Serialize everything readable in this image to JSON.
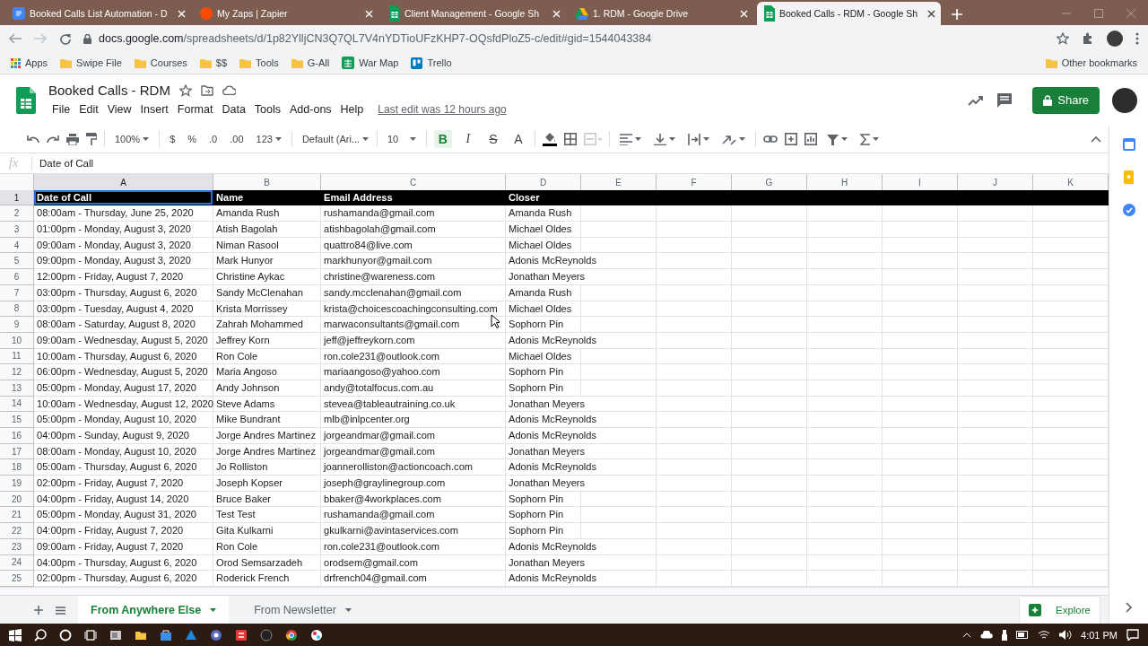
{
  "browser": {
    "tabs": [
      {
        "title": "Booked Calls List Automation - D",
        "kind": "docs",
        "selected": false
      },
      {
        "title": "My Zaps | Zapier",
        "kind": "zapier",
        "selected": false
      },
      {
        "title": "Client Management - Google Sh",
        "kind": "sheets",
        "selected": false
      },
      {
        "title": "1. RDM - Google Drive",
        "kind": "drive",
        "selected": false
      },
      {
        "title": "Booked Calls - RDM - Google Sh",
        "kind": "sheets",
        "selected": true
      }
    ],
    "url_host": "docs.google.com",
    "url_path": "/spreadsheets/d/1p82YlljCN3Q7QL7V4nYDTioUFzKHP7-OQsfdPloZ5-c/edit#gid=1544043384",
    "bookmarks": [
      {
        "label": "Apps",
        "kind": "apps"
      },
      {
        "label": "Swipe File",
        "kind": "folder"
      },
      {
        "label": "Courses",
        "kind": "folder"
      },
      {
        "label": "$$",
        "kind": "folder"
      },
      {
        "label": "Tools",
        "kind": "folder"
      },
      {
        "label": "G-All",
        "kind": "folder"
      },
      {
        "label": "War Map",
        "kind": "sheets"
      },
      {
        "label": "Trello",
        "kind": "trello"
      }
    ],
    "other_bookmarks": "Other bookmarks"
  },
  "sheet": {
    "title": "Booked Calls - RDM",
    "menu": [
      "File",
      "Edit",
      "View",
      "Insert",
      "Format",
      "Data",
      "Tools",
      "Add-ons",
      "Help"
    ],
    "last_edit": "Last edit was 12 hours ago",
    "share": "Share"
  },
  "toolbar": {
    "zoom": "100%",
    "currency": "$",
    "percent": "%",
    "decimal_less": ".0",
    "decimal_more": ".00",
    "number_format": "123",
    "font": "Default (Ari...",
    "font_size": "10",
    "format_buttons": [
      {
        "label": "B",
        "kind": "bold",
        "selected": true
      },
      {
        "label": "I",
        "kind": "italic",
        "selected": false
      },
      {
        "label": "S",
        "kind": "strike",
        "selected": false
      },
      {
        "label": "A",
        "kind": "color",
        "selected": false
      }
    ]
  },
  "formula": {
    "label": "fx",
    "value": "Date of Call"
  },
  "grid": {
    "columns": [
      {
        "letter": "A",
        "selected": true
      },
      {
        "letter": "B",
        "selected": false
      },
      {
        "letter": "C",
        "selected": false
      },
      {
        "letter": "D",
        "selected": false
      },
      {
        "letter": "E",
        "selected": false
      },
      {
        "letter": "F",
        "selected": false
      },
      {
        "letter": "G",
        "selected": false
      },
      {
        "letter": "H",
        "selected": false
      },
      {
        "letter": "I",
        "selected": false
      },
      {
        "letter": "J",
        "selected": false
      },
      {
        "letter": "K",
        "selected": false
      }
    ],
    "rows": [
      {
        "number": "1",
        "kind": "header",
        "selected": true,
        "cells": [
          "Date of Call",
          "Name",
          "Email Address",
          "Closer"
        ]
      },
      {
        "number": "2",
        "kind": "data",
        "selected": false,
        "cells": [
          "08:00am - Thursday, June 25, 2020",
          "Amanda Rush",
          "rushamanda@gmail.com",
          "Amanda Rush"
        ]
      },
      {
        "number": "3",
        "kind": "data",
        "selected": false,
        "cells": [
          "01:00pm - Monday, August 3, 2020",
          "Atish Bagolah",
          "atishbagolah@gmail.com",
          "Michael Oldes"
        ]
      },
      {
        "number": "4",
        "kind": "data",
        "selected": false,
        "cells": [
          "09:00am - Monday, August 3, 2020",
          "Niman Rasool",
          "quattro84@live.com",
          "Michael Oldes"
        ]
      },
      {
        "number": "5",
        "kind": "data",
        "selected": false,
        "cells": [
          "09:00pm - Monday, August 3, 2020",
          "Mark Hunyor",
          "markhunyor@gmail.com",
          "Adonis McReynolds"
        ]
      },
      {
        "number": "6",
        "kind": "data",
        "selected": false,
        "cells": [
          "12:00pm - Friday, August 7, 2020",
          "Christine Aykac",
          "christine@wareness.com",
          "Jonathan Meyers"
        ]
      },
      {
        "number": "7",
        "kind": "data",
        "selected": false,
        "cells": [
          "03:00pm - Thursday, August 6, 2020",
          "Sandy McClenahan",
          "sandy.mcclenahan@gmail.com",
          "Amanda Rush"
        ]
      },
      {
        "number": "8",
        "kind": "data",
        "selected": false,
        "cells": [
          "03:00pm - Tuesday, August 4, 2020",
          "Krista Morrissey",
          "krista@choicescoachingconsulting.com",
          "Michael Oldes"
        ]
      },
      {
        "number": "9",
        "kind": "data",
        "selected": false,
        "cells": [
          "08:00am - Saturday, August 8, 2020",
          "Zahrah Mohammed",
          "marwaconsultants@gmail.com",
          "Sophorn Pin"
        ]
      },
      {
        "number": "10",
        "kind": "data",
        "selected": false,
        "cells": [
          "09:00am - Wednesday, August 5, 2020",
          "Jeffrey Korn",
          "jeff@jeffreykorn.com",
          "Adonis McReynolds"
        ]
      },
      {
        "number": "11",
        "kind": "data",
        "selected": false,
        "cells": [
          "10:00am - Thursday, August 6, 2020",
          "Ron Cole",
          "ron.cole231@outlook.com",
          "Michael Oldes"
        ]
      },
      {
        "number": "12",
        "kind": "data",
        "selected": false,
        "cells": [
          "06:00pm - Wednesday, August 5, 2020",
          "Maria Angoso",
          "mariaangoso@yahoo.com",
          "Sophorn Pin"
        ]
      },
      {
        "number": "13",
        "kind": "data",
        "selected": false,
        "cells": [
          "05:00pm - Monday, August 17, 2020",
          "Andy Johnson",
          "andy@totalfocus.com.au",
          "Sophorn Pin"
        ]
      },
      {
        "number": "14",
        "kind": "data",
        "selected": false,
        "cells": [
          "10:00am - Wednesday, August 12, 2020",
          "Steve Adams",
          "stevea@tableautraining.co.uk",
          "Jonathan Meyers"
        ]
      },
      {
        "number": "15",
        "kind": "data",
        "selected": false,
        "cells": [
          "05:00pm - Monday, August 10, 2020",
          "Mike Bundrant",
          "mlb@inlpcenter.org",
          "Adonis McReynolds"
        ]
      },
      {
        "number": "16",
        "kind": "data",
        "selected": false,
        "cells": [
          "04:00pm - Sunday, August 9, 2020",
          "Jorge Andres Martinez",
          "jorgeandmar@gmail.com",
          "Adonis McReynolds"
        ]
      },
      {
        "number": "17",
        "kind": "data",
        "selected": false,
        "cells": [
          "08:00am - Monday, August 10, 2020",
          "Jorge Andres Martinez",
          "jorgeandmar@gmail.com",
          "Jonathan Meyers"
        ]
      },
      {
        "number": "18",
        "kind": "data",
        "selected": false,
        "cells": [
          "05:00am - Thursday, August 6, 2020",
          "Jo Rolliston",
          "joannerolliston@actioncoach.com",
          "Adonis McReynolds"
        ]
      },
      {
        "number": "19",
        "kind": "data",
        "selected": false,
        "cells": [
          "02:00pm - Friday, August 7, 2020",
          "Joseph Kopser",
          "joseph@graylinegroup.com",
          "Jonathan Meyers"
        ]
      },
      {
        "number": "20",
        "kind": "data",
        "selected": false,
        "cells": [
          "04:00pm - Friday, August 14, 2020",
          "Bruce Baker",
          "bbaker@4workplaces.com",
          "Sophorn Pin"
        ]
      },
      {
        "number": "21",
        "kind": "data",
        "selected": false,
        "cells": [
          "05:00pm - Monday, August 31, 2020",
          "Test Test",
          "rushamanda@gmail.com",
          "Sophorn Pin"
        ]
      },
      {
        "number": "22",
        "kind": "data",
        "selected": false,
        "cells": [
          "04:00pm - Friday, August 7, 2020",
          "Gita Kulkarni",
          "gkulkarni@avintaservices.com",
          "Sophorn Pin"
        ]
      },
      {
        "number": "23",
        "kind": "data",
        "selected": false,
        "cells": [
          "09:00am - Friday, August 7, 2020",
          "Ron Cole",
          "ron.cole231@outlook.com",
          "Adonis McReynolds"
        ]
      },
      {
        "number": "24",
        "kind": "data",
        "selected": false,
        "cells": [
          "04:00pm - Thursday, August 6, 2020",
          "Orod Semsarzadeh",
          "orodsem@gmail.com",
          "Jonathan Meyers"
        ]
      },
      {
        "number": "25",
        "kind": "data",
        "selected": false,
        "cells": [
          "02:00pm - Thursday, August 6, 2020",
          "Roderick French",
          "drfrench04@gmail.com",
          "Adonis McReynolds"
        ]
      }
    ]
  },
  "sheet_tabs": [
    {
      "label": "From Anywhere Else",
      "selected": true
    },
    {
      "label": "From Newsletter",
      "selected": false
    }
  ],
  "explore": "Explore",
  "taskbar": {
    "time": "4:01 PM"
  }
}
